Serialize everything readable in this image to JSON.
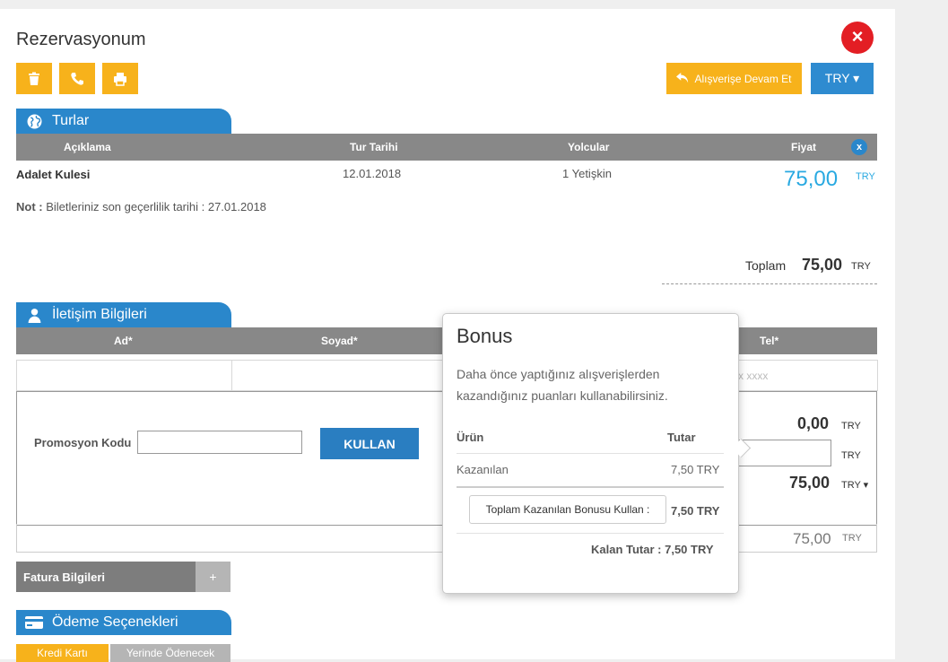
{
  "header": {
    "title": "Rezervasyonum",
    "close_icon": "×"
  },
  "toolbar": {
    "continue_label": "Alışverişe Devam Et",
    "currency_label": "TRY ▾"
  },
  "turlar": {
    "section_title": "Turlar",
    "columns": {
      "description": "Açıklama",
      "date": "Tur Tarihi",
      "passengers": "Yolcular",
      "price": "Fiyat"
    },
    "remove_icon": "x",
    "row": {
      "name": "Adalet Kulesi",
      "date": "12.01.2018",
      "passengers": "1 Yetişkin",
      "price": "75,00",
      "currency": "TRY"
    },
    "note_label": "Not :",
    "note_text": " Biletleriniz son geçerlilik tarihi : 27.01.2018",
    "total_label": "Toplam",
    "total_value": "75,00",
    "total_currency": "TRY"
  },
  "iletisim": {
    "section_title": "İletişim Bilgileri",
    "columns": {
      "first_name": "Ad*",
      "last_name": "Soyad*",
      "phone": "Tel*"
    },
    "phone_placeholder_fragment": "x xxxx"
  },
  "promo": {
    "label": "Promosyon Kodu",
    "button_label": "KULLAN",
    "amount1": "0,00",
    "currency1": "TRY",
    "currency2": "TRY",
    "amount3": "75,00",
    "currency3": "TRY ▾",
    "amount4": "75,00",
    "currency4": "TRY"
  },
  "fatura": {
    "label": "Fatura Bilgileri",
    "plus": "+"
  },
  "odeme": {
    "section_title": "Ödeme Seçenekleri",
    "option1": "Kredi Kartı",
    "option2": "Yerinde Ödenecek"
  },
  "bonus_popover": {
    "title": "Bonus",
    "text": "Daha önce yaptığınız alışverişlerden kazandığınız puanları kullanabilirsiniz.",
    "col_product": "Ürün",
    "col_amount": "Tutar",
    "row_label": "Kazanılan",
    "row_value": "7,50 TRY",
    "use_button_label": "Toplam Kazanılan Bonusu Kullan :",
    "use_value": "7,50 TRY",
    "remaining": "Kalan Tutar : 7,50 TRY"
  },
  "colors": {
    "accent_orange": "#f7b21b",
    "accent_blue": "#2a87cb",
    "close_red": "#e31e24",
    "price_blue": "#29a9e1"
  }
}
